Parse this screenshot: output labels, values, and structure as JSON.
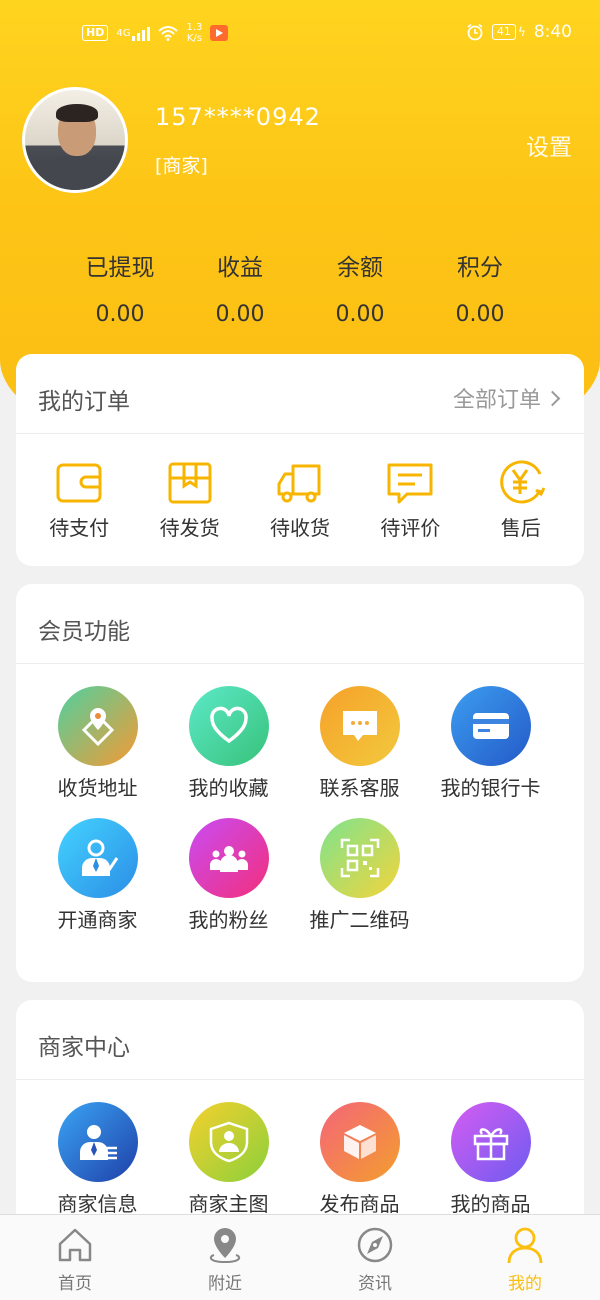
{
  "status_bar": {
    "hd": "HD",
    "network": "4G",
    "speed_value": "1.3",
    "speed_unit": "K/s",
    "battery": "41",
    "time": "8:40"
  },
  "profile": {
    "phone": "157****0942",
    "role": "[商家]",
    "settings_label": "设置"
  },
  "stats": [
    {
      "label": "已提现",
      "value": "0.00"
    },
    {
      "label": "收益",
      "value": "0.00"
    },
    {
      "label": "余额",
      "value": "0.00"
    },
    {
      "label": "积分",
      "value": "0.00"
    }
  ],
  "orders": {
    "title": "我的订单",
    "all_label": "全部订单",
    "items": [
      {
        "label": "待支付",
        "icon": "wallet-icon"
      },
      {
        "label": "待发货",
        "icon": "package-icon"
      },
      {
        "label": "待收货",
        "icon": "truck-icon"
      },
      {
        "label": "待评价",
        "icon": "comment-icon"
      },
      {
        "label": "售后",
        "icon": "yen-refund-icon"
      }
    ]
  },
  "member": {
    "title": "会员功能",
    "items": [
      {
        "label": "收货地址",
        "icon": "location-icon"
      },
      {
        "label": "我的收藏",
        "icon": "heart-icon"
      },
      {
        "label": "联系客服",
        "icon": "chat-icon"
      },
      {
        "label": "我的银行卡",
        "icon": "card-icon"
      },
      {
        "label": "开通商家",
        "icon": "businessman-icon"
      },
      {
        "label": "我的粉丝",
        "icon": "group-icon"
      },
      {
        "label": "推广二维码",
        "icon": "qr-code-icon"
      }
    ]
  },
  "merchant": {
    "title": "商家中心",
    "items": [
      {
        "label": "商家信息",
        "icon": "merchant-info-icon"
      },
      {
        "label": "商家主图",
        "icon": "merchant-image-icon"
      },
      {
        "label": "发布商品",
        "icon": "box-icon"
      },
      {
        "label": "我的商品",
        "icon": "gift-icon"
      }
    ]
  },
  "tabs": [
    {
      "label": "首页",
      "icon": "home-icon"
    },
    {
      "label": "附近",
      "icon": "pin-icon"
    },
    {
      "label": "资讯",
      "icon": "compass-icon"
    },
    {
      "label": "我的",
      "icon": "user-icon"
    }
  ],
  "colors": {
    "brand": "#fbbf0e",
    "tab_inactive": "#888888"
  }
}
